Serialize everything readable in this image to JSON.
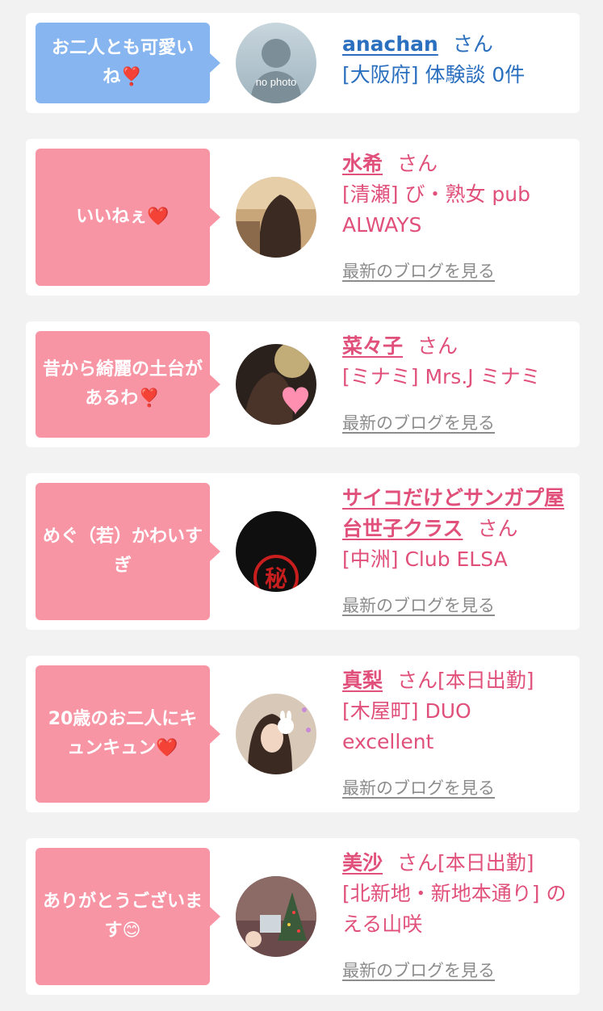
{
  "colors": {
    "background": "#f2f2f2",
    "card": "#ffffff",
    "bubble_blue": "#86b5f0",
    "bubble_pink": "#f895a5",
    "text_blue": "#2b6fbf",
    "text_pink": "#e0507a",
    "link_gray": "#8c8c8c"
  },
  "items": [
    {
      "comment": "お二人とも可愛いね❣️",
      "name": "anachan",
      "honorific": "さん",
      "shop": "[大阪府] 体験談 0件",
      "avatar_icon": "no-photo-avatar",
      "avatar_text": "no photo",
      "blog_link": ""
    },
    {
      "comment": "いいねぇ❤️",
      "name": "水希",
      "honorific": "さん",
      "shop": "[清瀬] び・熟女 pub ALWAYS",
      "avatar_icon": "girl-photo-avatar",
      "blog_link": "最新のブログを見る"
    },
    {
      "comment": "昔から綺麗の土台があるわ❣️",
      "name": "菜々子",
      "honorific": "さん",
      "shop": "[ミナミ] Mrs.J ミナミ",
      "avatar_icon": "girl-photo-avatar",
      "blog_link": "最新のブログを見る"
    },
    {
      "comment": "めぐ（若）かわいすぎ",
      "name": "サイコだけどサンガプ屋台世子クラス",
      "honorific": "さん",
      "shop": "[中洲] Club ELSA",
      "avatar_icon": "secret-stamp-avatar",
      "avatar_text": "秘",
      "blog_link": "最新のブログを見る"
    },
    {
      "comment": "20歳のお二人にキュンキュン❤️",
      "name": "真梨",
      "honorific": "さん[本日出勤]",
      "shop": "[木屋町] DUO excellent",
      "avatar_icon": "girl-photo-avatar",
      "blog_link": "最新のブログを見る"
    },
    {
      "comment": "ありがとうございます😊",
      "name": "美沙",
      "honorific": "さん[本日出勤]",
      "shop": "[北新地・新地本通り] のえる山咲",
      "avatar_icon": "girl-photo-avatar",
      "blog_link": "最新のブログを見る"
    }
  ]
}
